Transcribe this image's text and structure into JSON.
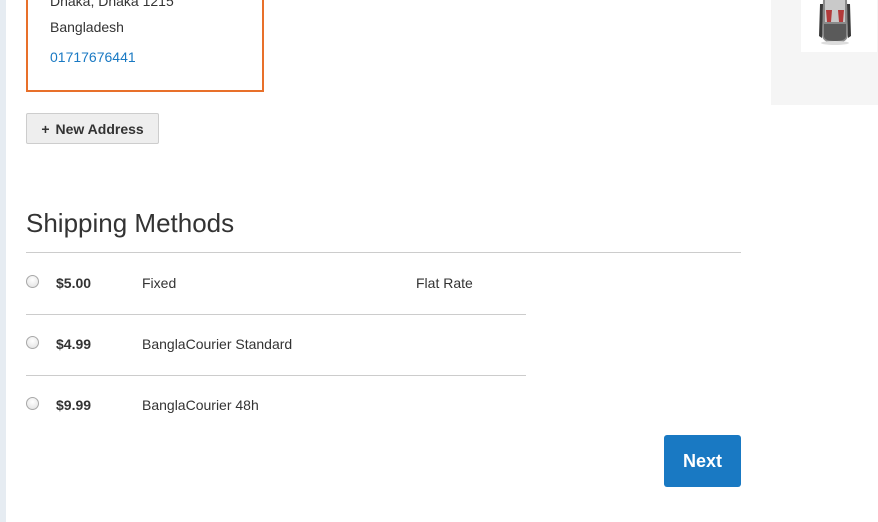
{
  "address": {
    "city_line": "Dhaka, Dhaka 1215",
    "country": "Bangladesh",
    "phone": "01717676441"
  },
  "new_address_button": {
    "icon": "plus-icon",
    "plus_glyph": "+",
    "label": "New Address"
  },
  "shipping": {
    "title": "Shipping Methods",
    "methods": [
      {
        "price": "$5.00",
        "method_title": "Fixed",
        "carrier_title": "Flat Rate",
        "selected": false
      },
      {
        "price": "$4.99",
        "method_title": "BanglaCourier Standard",
        "carrier_title": "",
        "selected": false
      },
      {
        "price": "$9.99",
        "method_title": "BanglaCourier 48h",
        "carrier_title": "",
        "selected": false
      }
    ]
  },
  "next_button": {
    "label": "Next"
  },
  "summary": {
    "product_image": "backpack-image"
  },
  "colors": {
    "accent": "#1979c3",
    "selected_border": "#e8702a",
    "divider": "#cccccc"
  }
}
